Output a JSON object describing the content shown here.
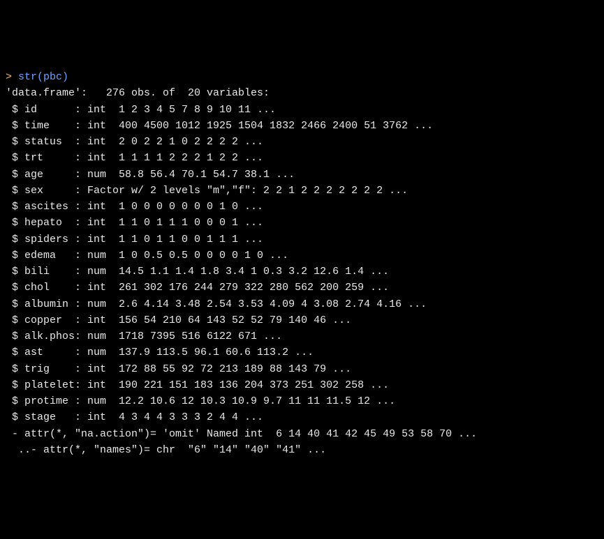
{
  "prompt": "> ",
  "command": "str(pbc)",
  "header": "'data.frame':   276 obs. of  20 variables:",
  "vars": [
    " $ id      : int  1 2 3 4 5 7 8 9 10 11 ...",
    " $ time    : int  400 4500 1012 1925 1504 1832 2466 2400 51 3762 ...",
    " $ status  : int  2 0 2 2 1 0 2 2 2 2 ...",
    " $ trt     : int  1 1 1 1 2 2 2 1 2 2 ...",
    " $ age     : num  58.8 56.4 70.1 54.7 38.1 ...",
    " $ sex     : Factor w/ 2 levels \"m\",\"f\": 2 2 1 2 2 2 2 2 2 2 ...",
    " $ ascites : int  1 0 0 0 0 0 0 0 1 0 ...",
    " $ hepato  : int  1 1 0 1 1 1 0 0 0 1 ...",
    " $ spiders : int  1 1 0 1 1 0 0 1 1 1 ...",
    " $ edema   : num  1 0 0.5 0.5 0 0 0 0 1 0 ...",
    " $ bili    : num  14.5 1.1 1.4 1.8 3.4 1 0.3 3.2 12.6 1.4 ...",
    " $ chol    : int  261 302 176 244 279 322 280 562 200 259 ...",
    " $ albumin : num  2.6 4.14 3.48 2.54 3.53 4.09 4 3.08 2.74 4.16 ...",
    " $ copper  : int  156 54 210 64 143 52 52 79 140 46 ...",
    " $ alk.phos: num  1718 7395 516 6122 671 ...",
    " $ ast     : num  137.9 113.5 96.1 60.6 113.2 ...",
    " $ trig    : int  172 88 55 92 72 213 189 88 143 79 ...",
    " $ platelet: int  190 221 151 183 136 204 373 251 302 258 ...",
    " $ protime : num  12.2 10.6 12 10.3 10.9 9.7 11 11 11.5 12 ...",
    " $ stage   : int  4 3 4 4 3 3 3 2 4 4 ..."
  ],
  "attr1": " - attr(*, \"na.action\")= 'omit' Named int  6 14 40 41 42 45 49 53 58 70 ...",
  "attr2": "  ..- attr(*, \"names\")= chr  \"6\" \"14\" \"40\" \"41\" ..."
}
